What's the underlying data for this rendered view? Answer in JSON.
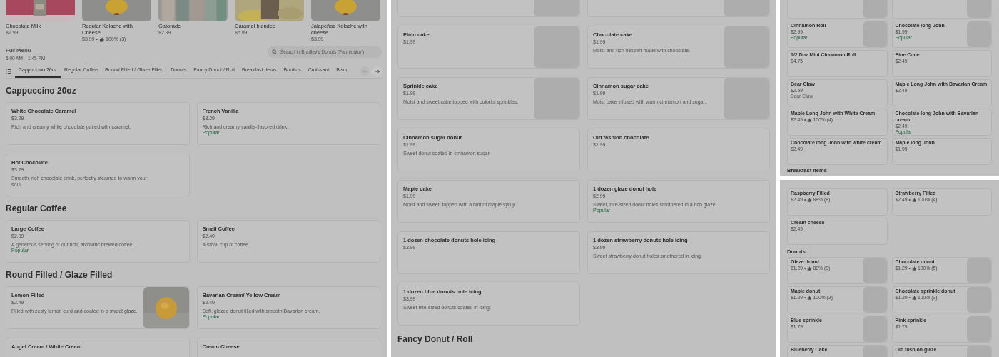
{
  "left": {
    "featured": [
      {
        "name": "Chocolate Milk",
        "price": "$2.99"
      },
      {
        "name": "Regular Kolache with Cheese",
        "price": "$3.99",
        "rating": {
          "separator": "•",
          "text": "100% (3)"
        }
      },
      {
        "name": "Gatorade",
        "price": "$2.99"
      },
      {
        "name": "Caramel blended",
        "price": "$5.99"
      },
      {
        "name": "Jalapeños Kolache with cheese",
        "price": "$3.99"
      }
    ],
    "menu_title": "Full Menu",
    "hours": "5:00 AM – 1:45 PM",
    "search": {
      "placeholder": "Search in Bradley's Donuts (Farmington)"
    },
    "tabs": [
      {
        "label": "Cappuccino 20oz",
        "selected": true
      },
      {
        "label": "Regular Coffee",
        "selected": false
      },
      {
        "label": "Round Filled / Glaze Filled",
        "selected": false
      },
      {
        "label": "Donuts",
        "selected": false
      },
      {
        "label": "Fancy Donut / Roll",
        "selected": false
      },
      {
        "label": "Breakfast Items",
        "selected": false
      },
      {
        "label": "Burritos",
        "selected": false
      },
      {
        "label": "Croissant",
        "selected": false
      },
      {
        "label": "Biscu",
        "selected": false
      }
    ],
    "scroll_buttons": [
      {
        "kind": "previous",
        "disabled": true
      },
      {
        "kind": "next",
        "disabled": false
      }
    ],
    "blocks": [
      {
        "kind": "heading",
        "text": "Cappuccino 20oz"
      },
      {
        "kind": "items",
        "items": [
          {
            "name": "White Chocolate Caramel",
            "price": "$3.29",
            "description": "Rich and creamy white chocolate paired with caramel."
          },
          {
            "name": "French Vanilla",
            "price": "$3.29",
            "description": "Rich and creamy vanilla-flavored drink.",
            "badge": "Popular"
          },
          {
            "name": "Hot Chocolate",
            "price": "$3.29",
            "description": "Smooth, rich chocolate drink, perfectly steamed to warm your soul."
          }
        ]
      },
      {
        "kind": "heading",
        "text": "Regular Coffee"
      },
      {
        "kind": "items",
        "items": [
          {
            "name": "Large Coffee",
            "price": "$2.99",
            "description": "A generous serving of our rich, aromatic brewed coffee.",
            "badge": "Popular"
          },
          {
            "name": "Small Coffee",
            "price": "$2.49",
            "description": "A small cup of coffee."
          }
        ]
      },
      {
        "kind": "heading",
        "text": "Round Filled / Glaze Filled"
      },
      {
        "kind": "items",
        "items": [
          {
            "name": "Lemon Filled",
            "price": "$2.49",
            "description": "Filled with zesty lemon curd and coated in a sweet glaze.",
            "image": true
          },
          {
            "name": "Bavarian Cream/ Yellow Cream",
            "price": "$2.49",
            "description": "Soft, glazed donut filled with smooth Bavarian cream.",
            "badge": "Popular"
          },
          {
            "name": "Angel Cream / White Cream"
          },
          {
            "name": "Cream Cheese"
          }
        ]
      }
    ]
  },
  "middle": {
    "blocks": [
      {
        "kind": "items",
        "items": [
          {
            "placeholder": true
          },
          {
            "placeholder": true
          },
          {
            "name": "Plain cake",
            "price": "$1.99",
            "placeholder": true
          },
          {
            "name": "Chocolate cake",
            "price": "$1.99",
            "description": "Moist and rich dessert made with chocolate.",
            "placeholder": true
          },
          {
            "name": "Sprinkle cake",
            "price": "$1.99",
            "description": "Moist and sweet cake topped with colorful sprinkles.",
            "placeholder": true
          },
          {
            "name": "Cinnamon sugar cake",
            "price": "$1.99",
            "description": "Moist cake infused with warm cinnamon and sugar.",
            "placeholder": true
          },
          {
            "name": "Cinnamon sugar donut",
            "price": "$1.99",
            "description": "Sweet donut coated in cinnamon sugar."
          },
          {
            "name": "Old fashion chocolate",
            "price": "$1.99"
          },
          {
            "name": "Maple cake",
            "price": "$1.99",
            "description": "Moist and sweet, topped with a hint of maple syrup."
          },
          {
            "name": "1 dozen glaze donut hole",
            "price": "$2.99",
            "description": "Sweet, bite-sized donut holes smothered in a rich glaze.",
            "badge": "Popular"
          },
          {
            "name": "1 dozen chocolate donuts hole icing",
            "price": "$3.99"
          },
          {
            "name": "1 dozen strawberry donuts hole icing",
            "price": "$3.99",
            "description": "Sweet strawberry donut holes smothered in icing."
          },
          {
            "name": "1 dozen blue donuts hole icing",
            "price": "$3.99",
            "description": "Sweet bite-sized donuts coated in icing."
          }
        ]
      },
      {
        "kind": "heading",
        "text": "Fancy Donut / Roll"
      }
    ]
  },
  "right_top": {
    "blocks": [
      {
        "kind": "items",
        "items": [
          {
            "placeholder": true
          },
          {
            "placeholder": true
          },
          {
            "name": "Cinnamon Roll",
            "price": "$2.99",
            "badge": "Popular",
            "placeholder": true
          },
          {
            "name": "Chocolate long John",
            "price": "$1.99",
            "badge": "Popular",
            "placeholder": true
          },
          {
            "name": "1/2 Doz Mini Cinnamon Roll",
            "price": "$4.75"
          },
          {
            "name": "Pine Cone",
            "price": "$2.49"
          },
          {
            "name": "Bear Claw",
            "price": "$2.59",
            "description": "Bear Claw"
          },
          {
            "name": "Maple Long John with Bavarian Cream",
            "price": "$2.49"
          },
          {
            "name": "Maple Long John with White Cream",
            "price": "$2.49",
            "rating": {
              "separator": "•",
              "text": "100% (4)"
            }
          },
          {
            "name": "Chocolate long John with Bavarian cream",
            "price": "$2.49",
            "badge": "Popular"
          },
          {
            "name": "Chocolate long John with white cream",
            "price": "$2.49"
          },
          {
            "name": "Maple long John",
            "price": "$1.99"
          }
        ]
      },
      {
        "kind": "heading",
        "text": "Breakfast Items"
      }
    ]
  },
  "right_bottom": {
    "blocks": [
      {
        "kind": "items",
        "items": [
          {
            "name": "Raspberry Filled",
            "price": "$2.49",
            "rating": {
              "separator": "•",
              "text": "88% (8)"
            }
          },
          {
            "name": "Strawberry Filled",
            "price": "$2.49",
            "rating": {
              "separator": "•",
              "text": "100% (4)"
            }
          },
          {
            "name": "Cream cheese",
            "price": "$2.49"
          }
        ]
      },
      {
        "kind": "heading",
        "text": "Donuts"
      },
      {
        "kind": "items",
        "items": [
          {
            "name": "Glaze donut",
            "price": "$1.29",
            "rating": {
              "separator": "•",
              "text": "88% (9)"
            },
            "placeholder": true
          },
          {
            "name": "Chocolate donut",
            "price": "$1.29",
            "rating": {
              "separator": "•",
              "text": "100% (5)"
            },
            "placeholder": true
          },
          {
            "name": "Maple donut",
            "price": "$1.29",
            "rating": {
              "separator": "•",
              "text": "100% (3)"
            },
            "placeholder": true
          },
          {
            "name": "Chocolate sprinkle donut",
            "price": "$1.29",
            "rating": {
              "separator": "•",
              "text": "100% (3)"
            },
            "placeholder": true
          },
          {
            "name": "Blue sprinkle",
            "price": "$1.79",
            "placeholder": true
          },
          {
            "name": "Pink sprinkle",
            "price": "$1.79",
            "placeholder": true
          },
          {
            "name": "Blueberry Cake",
            "placeholder": true
          },
          {
            "name": "Old fashion glaze",
            "placeholder": true
          }
        ]
      }
    ]
  }
}
